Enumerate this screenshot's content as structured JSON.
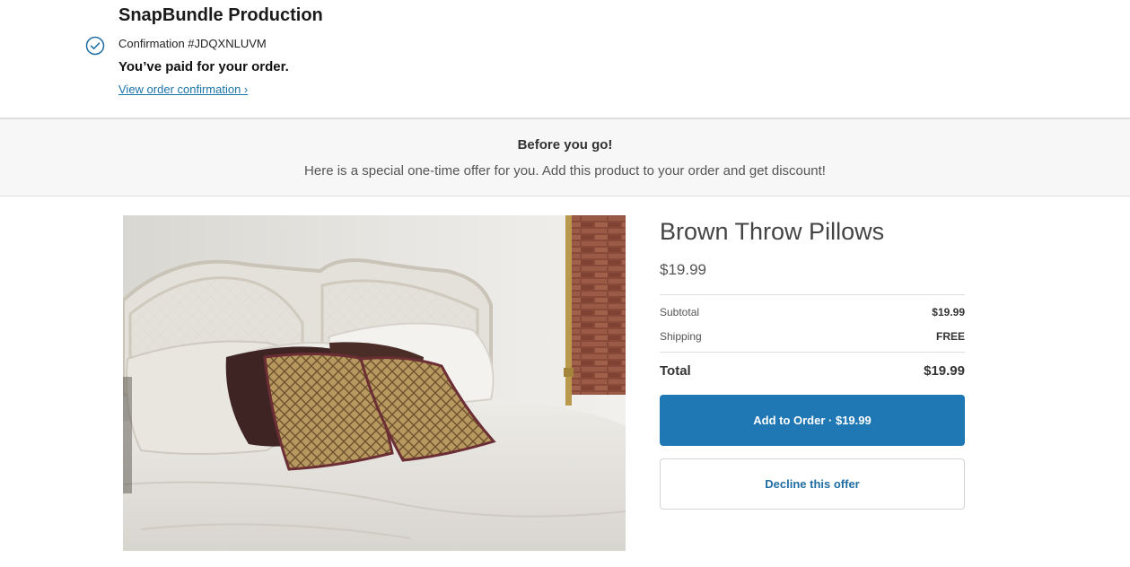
{
  "header": {
    "shop_name": "SnapBundle Production",
    "confirmation": "Confirmation #JDQXNLUVM",
    "paid_message": "You’ve paid for your order.",
    "view_link": "View order confirmation ›",
    "check_icon": "check-circle-icon"
  },
  "banner": {
    "title": "Before you go!",
    "text": "Here is a special one-time offer for you. Add this product to your order and get discount!"
  },
  "product": {
    "title": "Brown Throw Pillows",
    "price": "$19.99",
    "image": "product-photo"
  },
  "summary": {
    "subtotal_label": "Subtotal",
    "subtotal_value": "$19.99",
    "shipping_label": "Shipping",
    "shipping_value": "FREE",
    "total_label": "Total",
    "total_value": "$19.99"
  },
  "actions": {
    "add_label": "Add to Order · $19.99",
    "decline_label": "Decline this offer"
  },
  "colors": {
    "accent": "#1f78b4",
    "link": "#1a73a8"
  }
}
